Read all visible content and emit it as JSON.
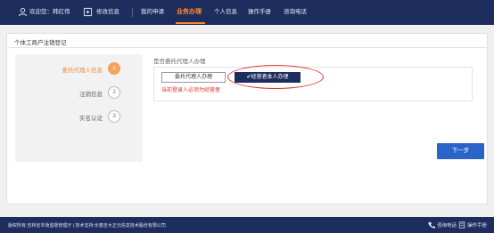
{
  "header": {
    "welcome": "欢迎您：韩红伟",
    "change_info": "修改信息",
    "nav": [
      "我的申请",
      "业务办理",
      "个人信息",
      "操作手册",
      "咨询电话"
    ],
    "active_index": 1
  },
  "panel": {
    "title": "个体工商户注销登记"
  },
  "steps": [
    {
      "label": "委托代理人信息",
      "number": "1",
      "active": true
    },
    {
      "label": "注销信息",
      "number": "2",
      "active": false
    },
    {
      "label": "实名认证",
      "number": "3",
      "active": false
    }
  ],
  "form": {
    "question": "是否委托代理人办理",
    "option_a": "委托代理人办理",
    "option_b": "✔经营者本人办理",
    "selected": "option_b",
    "warning": "当前登录人必须为经营者"
  },
  "actions": {
    "next_label": "下一步"
  },
  "footer": {
    "copyright": "版权所有:吉林省市场监督管理厅 | 技术支持:长春吉大正元信息技术股份有限公司",
    "consult": "咨询电话",
    "manual": "操作手册"
  },
  "colors": {
    "nav_bg": "#1d2e5e",
    "accent": "#ff8a2a",
    "primary_button": "#2a64c9",
    "warning": "#e0352b"
  }
}
